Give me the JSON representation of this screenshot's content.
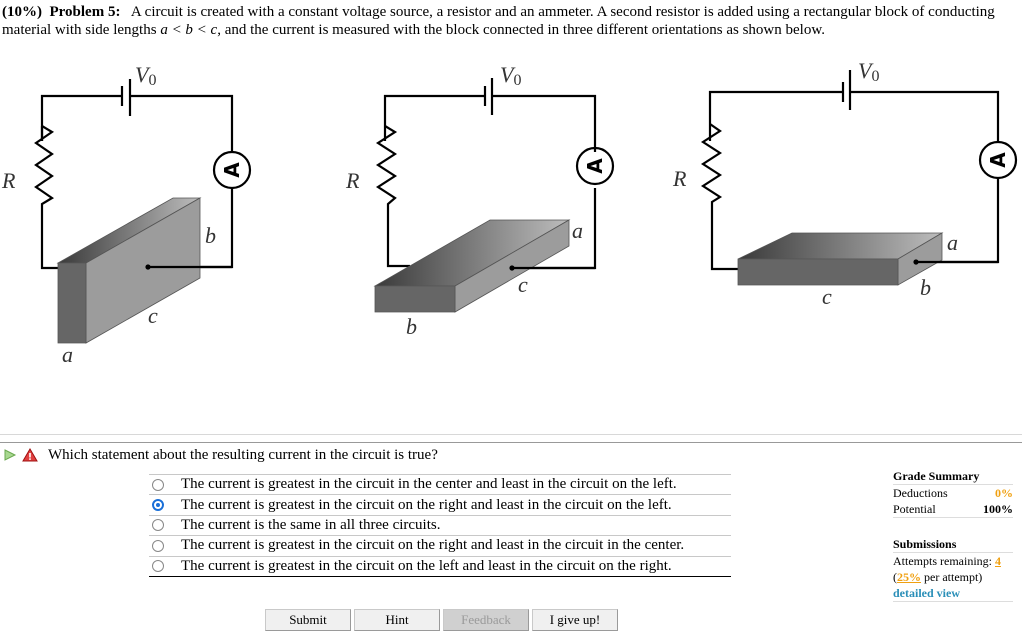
{
  "problem": {
    "weight": "(10%)",
    "number_label": "Problem 5:",
    "text_part1": "A circuit is created with a constant voltage source, a resistor and an ammeter. A second resistor is added using a rectangular block of conducting material with side lengths ",
    "inequality": "a < b < c",
    "text_part2": ", and the current is measured with the block connected in three different orientations as shown below."
  },
  "figure": {
    "voltage_label": "V",
    "voltage_subscript": "0",
    "resistor_label": "R",
    "ammeter_label": "A",
    "circuits": [
      {
        "name": "left",
        "labels": {
          "front_width": "a",
          "height": "b",
          "length": "c"
        }
      },
      {
        "name": "center",
        "labels": {
          "front_width": "b",
          "height": "a",
          "length": "c"
        }
      },
      {
        "name": "right",
        "labels": {
          "front_width": "c",
          "height": "a",
          "depth": "b"
        }
      }
    ]
  },
  "question": {
    "text": "Which statement about the resulting current in the circuit is true?",
    "choices": [
      {
        "label": "The current is greatest in the circuit in the center and least in the circuit on the left.",
        "selected": false
      },
      {
        "label": "The current is greatest in the circuit on the right and least in the circuit on the left.",
        "selected": true
      },
      {
        "label": "The current is the same in all three circuits.",
        "selected": false
      },
      {
        "label": "The current is greatest in the circuit on the right and least in the circuit in the center.",
        "selected": false
      },
      {
        "label": "The current is greatest in the circuit on the left and least in the circuit on the right.",
        "selected": false
      }
    ]
  },
  "buttons": {
    "submit": "Submit",
    "hint": "Hint",
    "feedback": "Feedback",
    "give_up": "I give up!"
  },
  "grade_summary": {
    "title": "Grade Summary",
    "deductions_label": "Deductions",
    "deductions_value": "0%",
    "potential_label": "Potential",
    "potential_value": "100%"
  },
  "submissions": {
    "title": "Submissions",
    "attempts_label": "Attempts remaining:",
    "attempts_value": "4",
    "per_attempt_open": "(",
    "per_attempt_value": "25%",
    "per_attempt_label": " per attempt)",
    "detailed_view": "detailed view"
  },
  "colors": {
    "accent_orange": "#f0a010",
    "link_teal": "#2a8fb8",
    "radio_selected": "#1a6fd8"
  }
}
